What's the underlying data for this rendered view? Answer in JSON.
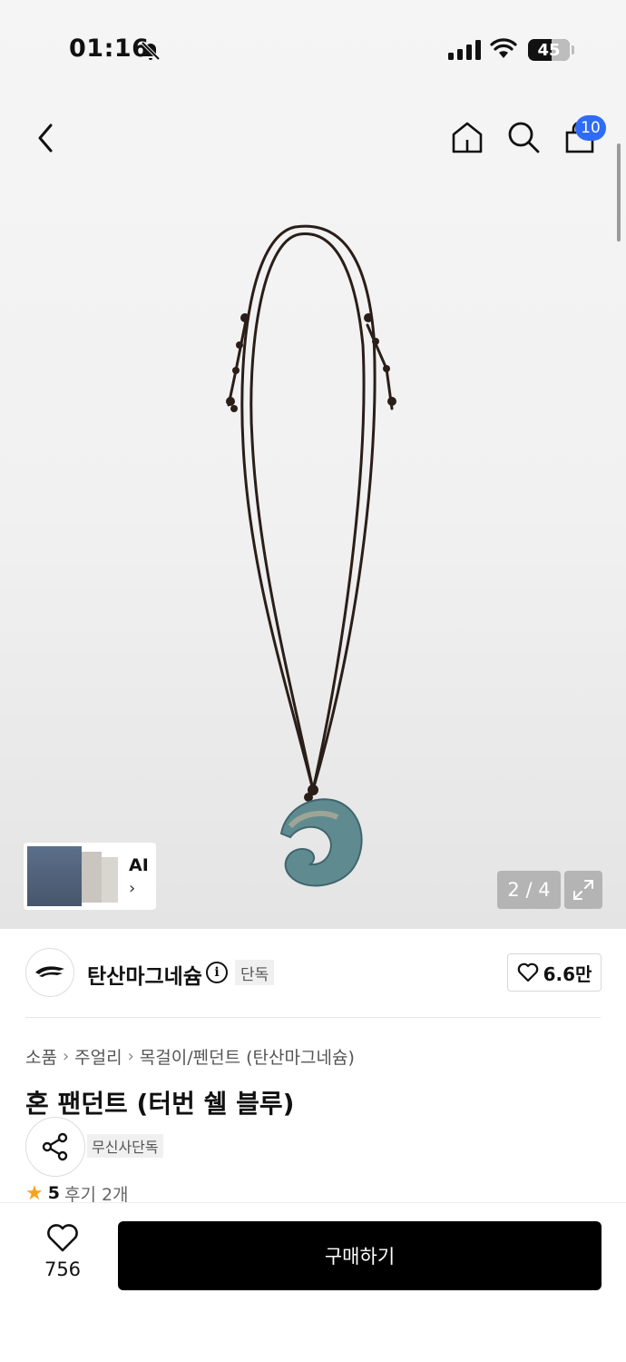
{
  "status_bar": {
    "time": "01:16",
    "battery": "45",
    "icons": [
      "bell-muted-icon",
      "signal-icon",
      "wifi-icon",
      "battery-icon"
    ]
  },
  "nav": {
    "cart_count": "10",
    "icons": [
      "back-icon",
      "home-icon",
      "search-icon",
      "cart-icon"
    ]
  },
  "gallery": {
    "page_indicator": "2 / 4",
    "ai_label": "AI"
  },
  "brand": {
    "name": "탄산마그네슘",
    "tag": "단독",
    "likes": "6.6만"
  },
  "product": {
    "breadcrumb": [
      "소품",
      "주얼리",
      "목걸이/펜던트 (탄산마그네슘)"
    ],
    "title": "혼 팬던트 (터번 쉘 블루)",
    "exclusive_tag": "무신사단독",
    "rating": "5",
    "reviews": "후기 2개"
  },
  "bottom": {
    "wish_count": "756",
    "buy_label": "구매하기"
  },
  "colors": {
    "accent_badge": "#2f6cf6",
    "star": "#f7a21b",
    "buy_button": "#000000"
  }
}
